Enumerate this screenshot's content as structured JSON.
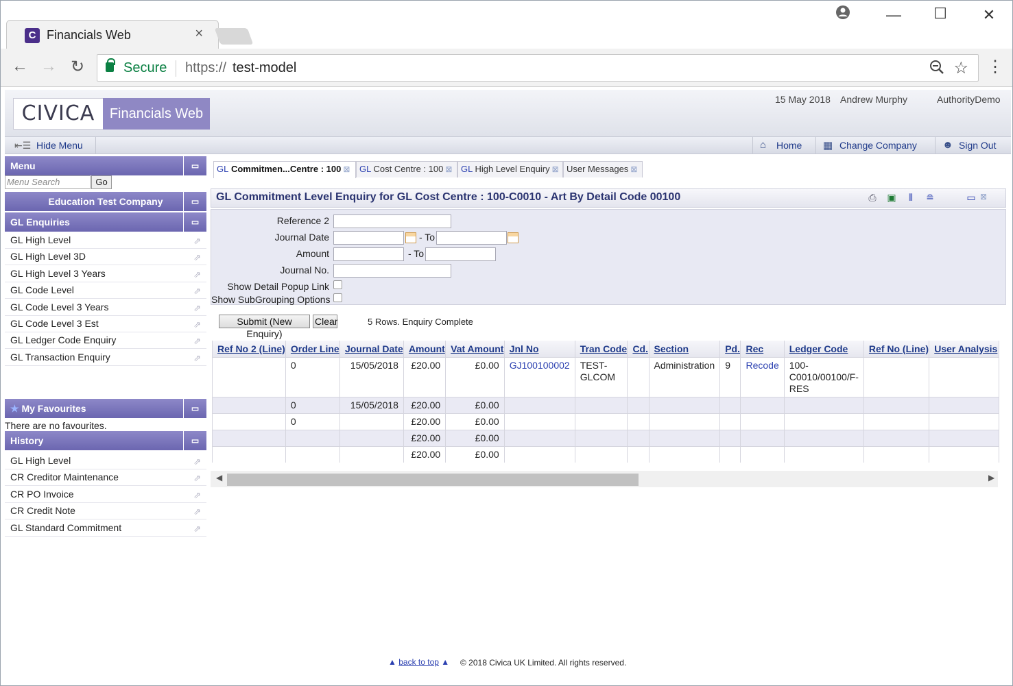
{
  "browser": {
    "tab_title": "Financials Web",
    "tab_favicon": "C",
    "security_label": "Secure",
    "url_scheme": "https://",
    "url_host": "test-model"
  },
  "app": {
    "logo_text": "CIVICA",
    "product_name": "Financials Web",
    "date": "15 May 2018",
    "user": "Andrew Murphy",
    "authority": "AuthorityDemo",
    "hide_menu_label": "Hide Menu",
    "nav_links": [
      "Home",
      "Change Company",
      "Sign Out"
    ]
  },
  "sidebar": {
    "menu_title": "Menu",
    "search_placeholder": "Menu Search",
    "go_label": "Go",
    "company": "Education Test Company",
    "section_title": "GL Enquiries",
    "items": [
      "GL High Level",
      "GL High Level 3D",
      "GL High Level 3 Years",
      "GL Code Level",
      "GL Code Level 3 Years",
      "GL Code Level 3 Est",
      "GL Ledger Code Enquiry",
      "GL Transaction Enquiry"
    ],
    "favourites_title": "My Favourites",
    "favourites_empty": "There are no favourites.",
    "history_title": "History",
    "history": [
      "GL High Level",
      "CR Creditor Maintenance",
      "CR PO Invoice",
      "CR Credit Note",
      "GL Standard Commitment"
    ]
  },
  "page_tabs": [
    {
      "prefix": "GL",
      "label": " Commitmen...Centre : 100"
    },
    {
      "prefix": "GL",
      "label": " Cost Centre : 100"
    },
    {
      "prefix": "GL",
      "label": " High Level Enquiry"
    },
    {
      "prefix": "",
      "label": "User Messages"
    }
  ],
  "enquiry": {
    "title": "GL Commitment Level Enquiry for GL Cost Centre : 100-C0010 - Art By Detail Code 00100",
    "form": {
      "reference2_label": "Reference 2",
      "journal_date_label": "Journal Date",
      "to_label": "- To",
      "amount_label": "Amount",
      "journal_no_label": "Journal No.",
      "detail_popup_label": "Show Detail Popup Link",
      "subgrouping_label": "Show SubGrouping Options"
    },
    "submit_label": "Submit (New Enquiry)",
    "clear_label": "Clear",
    "status": "5 Rows. Enquiry Complete"
  },
  "table": {
    "columns": [
      "Ref No 2 (Line)",
      "Order Line",
      "Journal Date",
      "Amount",
      "Vat Amount",
      "Jnl No",
      "Tran Code",
      "Cd.",
      "Section",
      "Pd.",
      "Rec",
      "Ledger Code",
      "Ref No (Line)",
      "User Analysis"
    ],
    "rows": [
      [
        "",
        "0",
        "15/05/2018",
        "£20.00",
        "£0.00",
        "GJ100100002",
        "TEST-GLCOM",
        "",
        "Administration",
        "9",
        "Recode",
        "100-C0010/00100/F-RES",
        "",
        ""
      ],
      [
        "",
        "0",
        "15/05/2018",
        "£20.00",
        "£0.00",
        "",
        "",
        "",
        "",
        "",
        "",
        "",
        "",
        ""
      ],
      [
        "",
        "0",
        "",
        "£20.00",
        "£0.00",
        "",
        "",
        "",
        "",
        "",
        "",
        "",
        "",
        ""
      ],
      [
        "",
        "",
        "",
        "£20.00",
        "£0.00",
        "",
        "",
        "",
        "",
        "",
        "",
        "",
        "",
        ""
      ],
      [
        "",
        "",
        "",
        "£20.00",
        "£0.00",
        "",
        "",
        "",
        "",
        "",
        "",
        "",
        "",
        ""
      ]
    ]
  },
  "footer": {
    "back_to_top": "back to top",
    "copyright": "© 2018 Civica UK Limited. All rights reserved."
  }
}
